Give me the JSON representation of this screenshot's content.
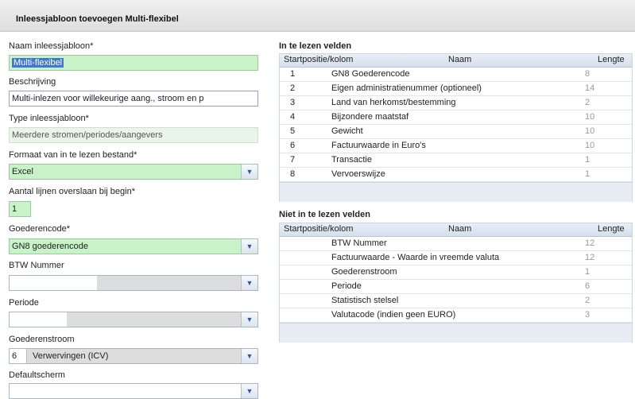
{
  "title": "Inleessjabloon toevoegen Multi-flexibel",
  "form": {
    "naam_label": "Naam inleessjabloon*",
    "naam_value": "Multi-flexibel",
    "beschrijving_label": "Beschrijving",
    "beschrijving_value": "Multi-inlezen voor willekeurige aang., stroom en p",
    "type_label": "Type inleessjabloon*",
    "type_value": "Meerdere stromen/periodes/aangevers",
    "formaat_label": "Formaat van in te lezen bestand*",
    "formaat_value": "Excel",
    "aantal_label": "Aantal lijnen overslaan bij begin*",
    "aantal_value": "1",
    "goederencode_label": "Goederencode*",
    "goederencode_value": "GN8 goederencode",
    "btw_label": "BTW Nummer",
    "btw_value": "",
    "periode_label": "Periode",
    "periode_value": "",
    "goederenstroom_label": "Goederenstroom",
    "goederenstroom_code": "6",
    "goederenstroom_value": "Verwervingen (ICV)",
    "default_label": "Defaultscherm",
    "default_value": ""
  },
  "in_te_lezen": {
    "title": "In te lezen velden",
    "headers": {
      "pos": "Startpositie/kolom",
      "naam": "Naam",
      "lengte": "Lengte"
    },
    "rows": [
      {
        "pos": "1",
        "naam": "GN8 Goederencode",
        "lengte": "8"
      },
      {
        "pos": "2",
        "naam": "Eigen administratienummer (optioneel)",
        "lengte": "14"
      },
      {
        "pos": "3",
        "naam": "Land van herkomst/bestemming",
        "lengte": "2"
      },
      {
        "pos": "4",
        "naam": "Bijzondere maatstaf",
        "lengte": "10"
      },
      {
        "pos": "5",
        "naam": "Gewicht",
        "lengte": "10"
      },
      {
        "pos": "6",
        "naam": "Factuurwaarde in Euro's",
        "lengte": "10"
      },
      {
        "pos": "7",
        "naam": "Transactie",
        "lengte": "1"
      },
      {
        "pos": "8",
        "naam": "Vervoerswijze",
        "lengte": "1"
      }
    ]
  },
  "niet_in_te_lezen": {
    "title": "Niet in te lezen velden",
    "headers": {
      "pos": "Startpositie/kolom",
      "naam": "Naam",
      "lengte": "Lengte"
    },
    "rows": [
      {
        "pos": "",
        "naam": "BTW Nummer",
        "lengte": "12"
      },
      {
        "pos": "",
        "naam": "Factuurwaarde - Waarde in vreemde valuta",
        "lengte": "12"
      },
      {
        "pos": "",
        "naam": "Goederenstroom",
        "lengte": "1"
      },
      {
        "pos": "",
        "naam": "Periode",
        "lengte": "6"
      },
      {
        "pos": "",
        "naam": "Statistisch stelsel",
        "lengte": "2"
      },
      {
        "pos": "",
        "naam": "Valutacode (indien geen EURO)",
        "lengte": "3"
      }
    ]
  },
  "icons": {
    "dropdown": "chevron-down-icon"
  }
}
